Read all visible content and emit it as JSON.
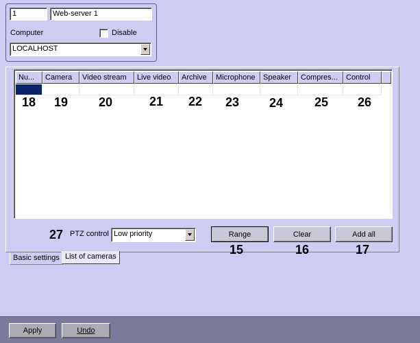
{
  "server": {
    "id": "1",
    "name": "Web-server 1",
    "computer_label": "Computer",
    "disable_label": "Disable",
    "disable_checked": false,
    "computer_value": "LOCALHOST"
  },
  "camera_list": {
    "columns": [
      "Nu...",
      "Camera",
      "Video stream",
      "Live video",
      "Archive",
      "Microphone",
      "Speaker",
      "Compres...",
      "Control"
    ],
    "annotations": {
      "number_col": "18",
      "camera_col": "19",
      "video_stream_col": "20",
      "live_video_col": "21",
      "archive_col": "22",
      "microphone_col": "23",
      "speaker_col": "24",
      "compression_col": "25",
      "control_col": "26",
      "ptz": "27",
      "range": "15",
      "clear": "16",
      "add_all": "17"
    },
    "ptz_label": "PTZ control",
    "ptz_value": "Low priority",
    "range_label": "Range",
    "clear_label": "Clear",
    "add_all_label": "Add all"
  },
  "tabs": [
    {
      "label": "Basic settings",
      "active": false
    },
    {
      "label": "List of cameras",
      "active": true
    }
  ],
  "footer": {
    "apply_label": "Apply",
    "undo_label": "Undo"
  },
  "colors": {
    "background": "#ccccf5",
    "selection": "#0a246a",
    "footer": "#7a7a9a"
  }
}
